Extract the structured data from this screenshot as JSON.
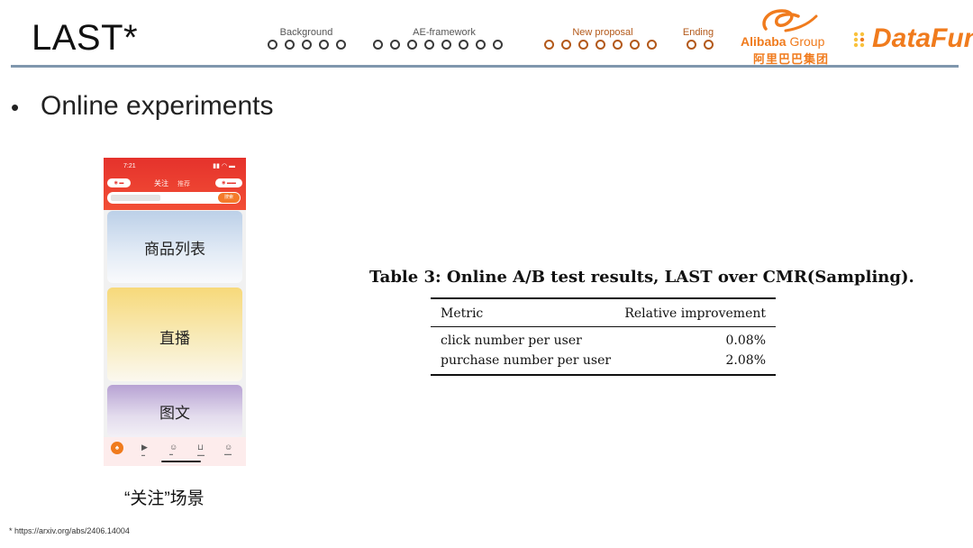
{
  "header": {
    "title": "LAST*",
    "sections": [
      {
        "label": "Background",
        "dots": 5,
        "current": -1
      },
      {
        "label": "AE-framework",
        "dots": 8,
        "current": -1
      },
      {
        "label": "New proposal",
        "dots": 7,
        "current": 6
      },
      {
        "label": "Ending",
        "dots": 2,
        "current": -1
      }
    ],
    "active_section": "New proposal",
    "accent_color": "#e07a1f"
  },
  "logos": {
    "alibaba_brand": "Alibaba",
    "alibaba_group": " Group",
    "alibaba_cn": "阿里巴巴集团",
    "datafun": "DataFun."
  },
  "bullet": {
    "text": "Online experiments"
  },
  "phone": {
    "time": "7:21",
    "tab_follow": "关注",
    "tab_recommend": "推荐",
    "search_button": "搜索",
    "cards": [
      "商品列表",
      "直播",
      "图文"
    ],
    "caption": "“关注”场景"
  },
  "table": {
    "caption": "Table 3: Online A/B test results, LAST over CMR(Sampling).",
    "headers": [
      "Metric",
      "Relative improvement"
    ],
    "rows": [
      [
        "click number per user",
        "0.08%"
      ],
      [
        "purchase number per user",
        "2.08%"
      ]
    ]
  },
  "footnote": "* https://arxiv.org/abs/2406.14004"
}
